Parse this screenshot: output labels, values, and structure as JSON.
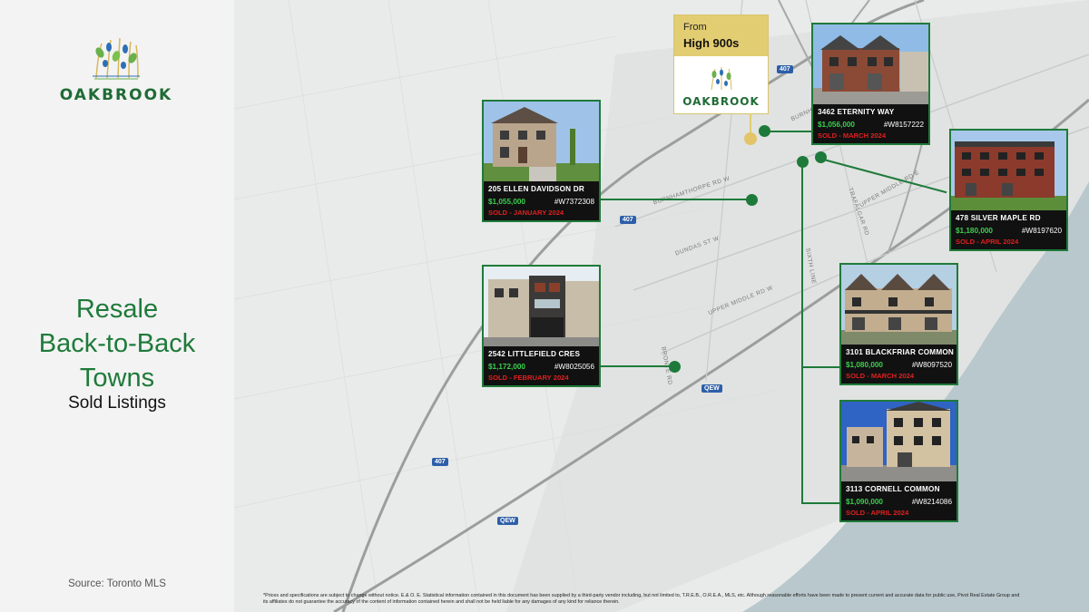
{
  "brand": {
    "name": "OAKBROOK"
  },
  "headline": {
    "line1": "Resale",
    "line2": "Back-to-Back",
    "line3": "Towns",
    "sub": "Sold Listings"
  },
  "source": "Source: Toronto MLS",
  "callout": {
    "from_label": "From",
    "price": "High 900s",
    "brand": "OAKBROOK",
    "accent": "#e3cd72"
  },
  "roads": {
    "burnhamthorpe_upper": "BURNHAMTHORPE RD W",
    "burnhamthorpe": "BURNHAMTHORPE RD W",
    "dundas": "DUNDAS ST W",
    "upper_middle": "UPPER MIDDLE RD W",
    "upper_middle_east": "UPPER MIDDLE RD E",
    "trafalgar": "TRAFALGAR RD",
    "sixth_line": "SIXTH LINE",
    "bronte": "BRONTE RD",
    "hwy407": "407",
    "qew": "QEW"
  },
  "listings": [
    {
      "address": "205 ELLEN DAVIDSON DR",
      "price": "$1,055,000",
      "mls": "#W7372308",
      "sold": "SOLD - JANUARY 2024"
    },
    {
      "address": "2542 LITTLEFIELD CRES",
      "price": "$1,172,000",
      "mls": "#W8025056",
      "sold": "SOLD - FEBRUARY 2024"
    },
    {
      "address": "3462 ETERNITY WAY",
      "price": "$1,056,000",
      "mls": "#W8157222",
      "sold": "SOLD - MARCH 2024"
    },
    {
      "address": "478 SILVER MAPLE RD",
      "price": "$1,180,000",
      "mls": "#W8197620",
      "sold": "SOLD - APRIL 2024"
    },
    {
      "address": "3101 BLACKFRIAR COMMON",
      "price": "$1,080,000",
      "mls": "#W8097520",
      "sold": "SOLD - MARCH 2024"
    },
    {
      "address": "3113 CORNELL COMMON",
      "price": "$1,090,000",
      "mls": "#W8214086",
      "sold": "SOLD - APRIL 2024"
    }
  ],
  "colors": {
    "brand_green": "#1e7a3a",
    "price_green": "#3ccf4e",
    "sold_red": "#e02020",
    "water": "#b8c8cc"
  },
  "disclaimer": "*Prices and specifications are subject to change without notice. E.& O. E. Statistical information contained in this document has been supplied by a third-party vendor including, but not limited to, T.R.E.B., O.R.E.A., MLS, etc. Although reasonable efforts have been made to present current and accurate data for public use, Pivot Real Estate Group and its affiliates do not guarantee the accuracy of the content of information contained herein and shall not be held liable for any damages of any kind for reliance therein."
}
